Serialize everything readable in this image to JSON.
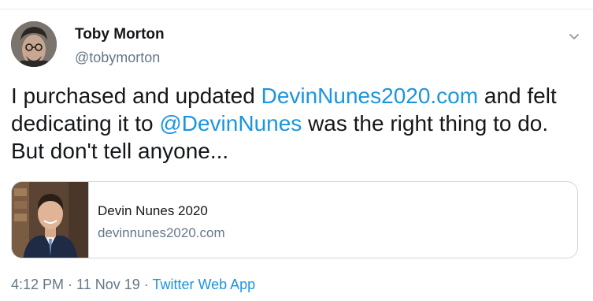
{
  "user": {
    "name": "Toby Morton",
    "handle": "@tobymorton"
  },
  "tweet": {
    "text_1": "I purchased and updated ",
    "link_domain": "DevinNunes2020.com",
    "text_2": " and felt dedicating it to ",
    "mention": "@DevinNunes",
    "text_3": " was the right thing to do. But don't tell anyone..."
  },
  "card": {
    "title": "Devin Nunes 2020",
    "domain": "devinnunes2020.com"
  },
  "meta": {
    "time": "4:12 PM",
    "sep_1": " · ",
    "date": "11 Nov 19",
    "sep_2": " · ",
    "source": "Twitter Web App"
  },
  "icons": {
    "menu": "chevron-down-icon"
  },
  "colors": {
    "link": "#1b95e0",
    "text": "#14171a",
    "secondary": "#657786",
    "border": "#ccd6dd"
  }
}
